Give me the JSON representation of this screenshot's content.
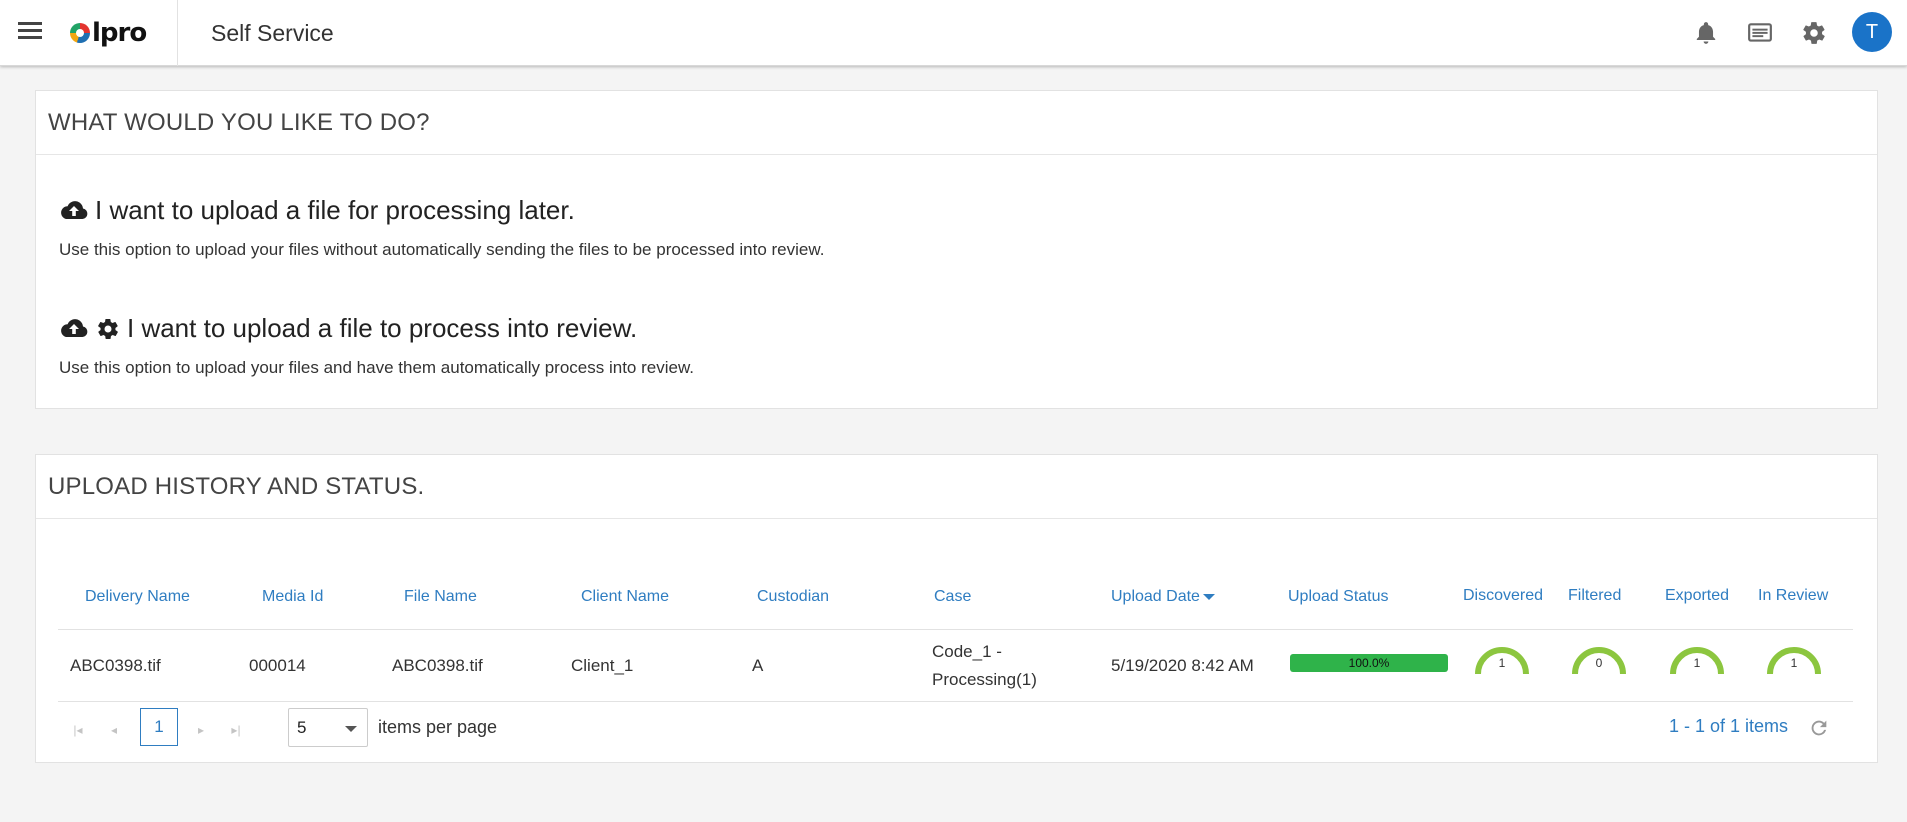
{
  "header": {
    "logo_text": "lpro",
    "app_title": "Self Service",
    "avatar_initial": "T",
    "icons": [
      "menu-icon",
      "bell-icon",
      "message-icon",
      "gear-icon"
    ]
  },
  "actions": {
    "title": "WHAT WOULD YOU LIKE TO DO?",
    "options": [
      {
        "title": "I want to upload a file for processing later.",
        "desc": "Use this option to upload your files without automatically sending the files to be processed into review."
      },
      {
        "title": "I want to upload a file to process into review.",
        "desc": "Use this option to upload your files and have them automatically process into review."
      }
    ]
  },
  "history": {
    "title": "UPLOAD HISTORY AND STATUS.",
    "columns": [
      "Delivery Name",
      "Media Id",
      "File Name",
      "Client Name",
      "Custodian",
      "Case",
      "Upload Date",
      "Upload Status",
      "Discovered",
      "Filtered",
      "Exported",
      "In Review"
    ],
    "rows": [
      {
        "delivery_name": "ABC0398.tif",
        "media_id": "000014",
        "file_name": "ABC0398.tif",
        "client_name": "Client_1",
        "custodian": "A",
        "case_line1": "Code_1 -",
        "case_line2": "Processing(1)",
        "upload_date": "5/19/2020 8:42 AM",
        "upload_status_pct": 100,
        "upload_status_text": "100.0%",
        "discovered": "1",
        "filtered": "0",
        "exported": "1",
        "in_review": "1"
      }
    ],
    "pager": {
      "current_page": "1",
      "page_size": "5",
      "items_per_page_label": "items per page",
      "info": "1 - 1 of 1 items"
    }
  },
  "colors": {
    "accent": "#2f7dc1",
    "progress": "#2fb34a",
    "gauge": "#8cc63f",
    "avatar": "#1a73c8"
  }
}
